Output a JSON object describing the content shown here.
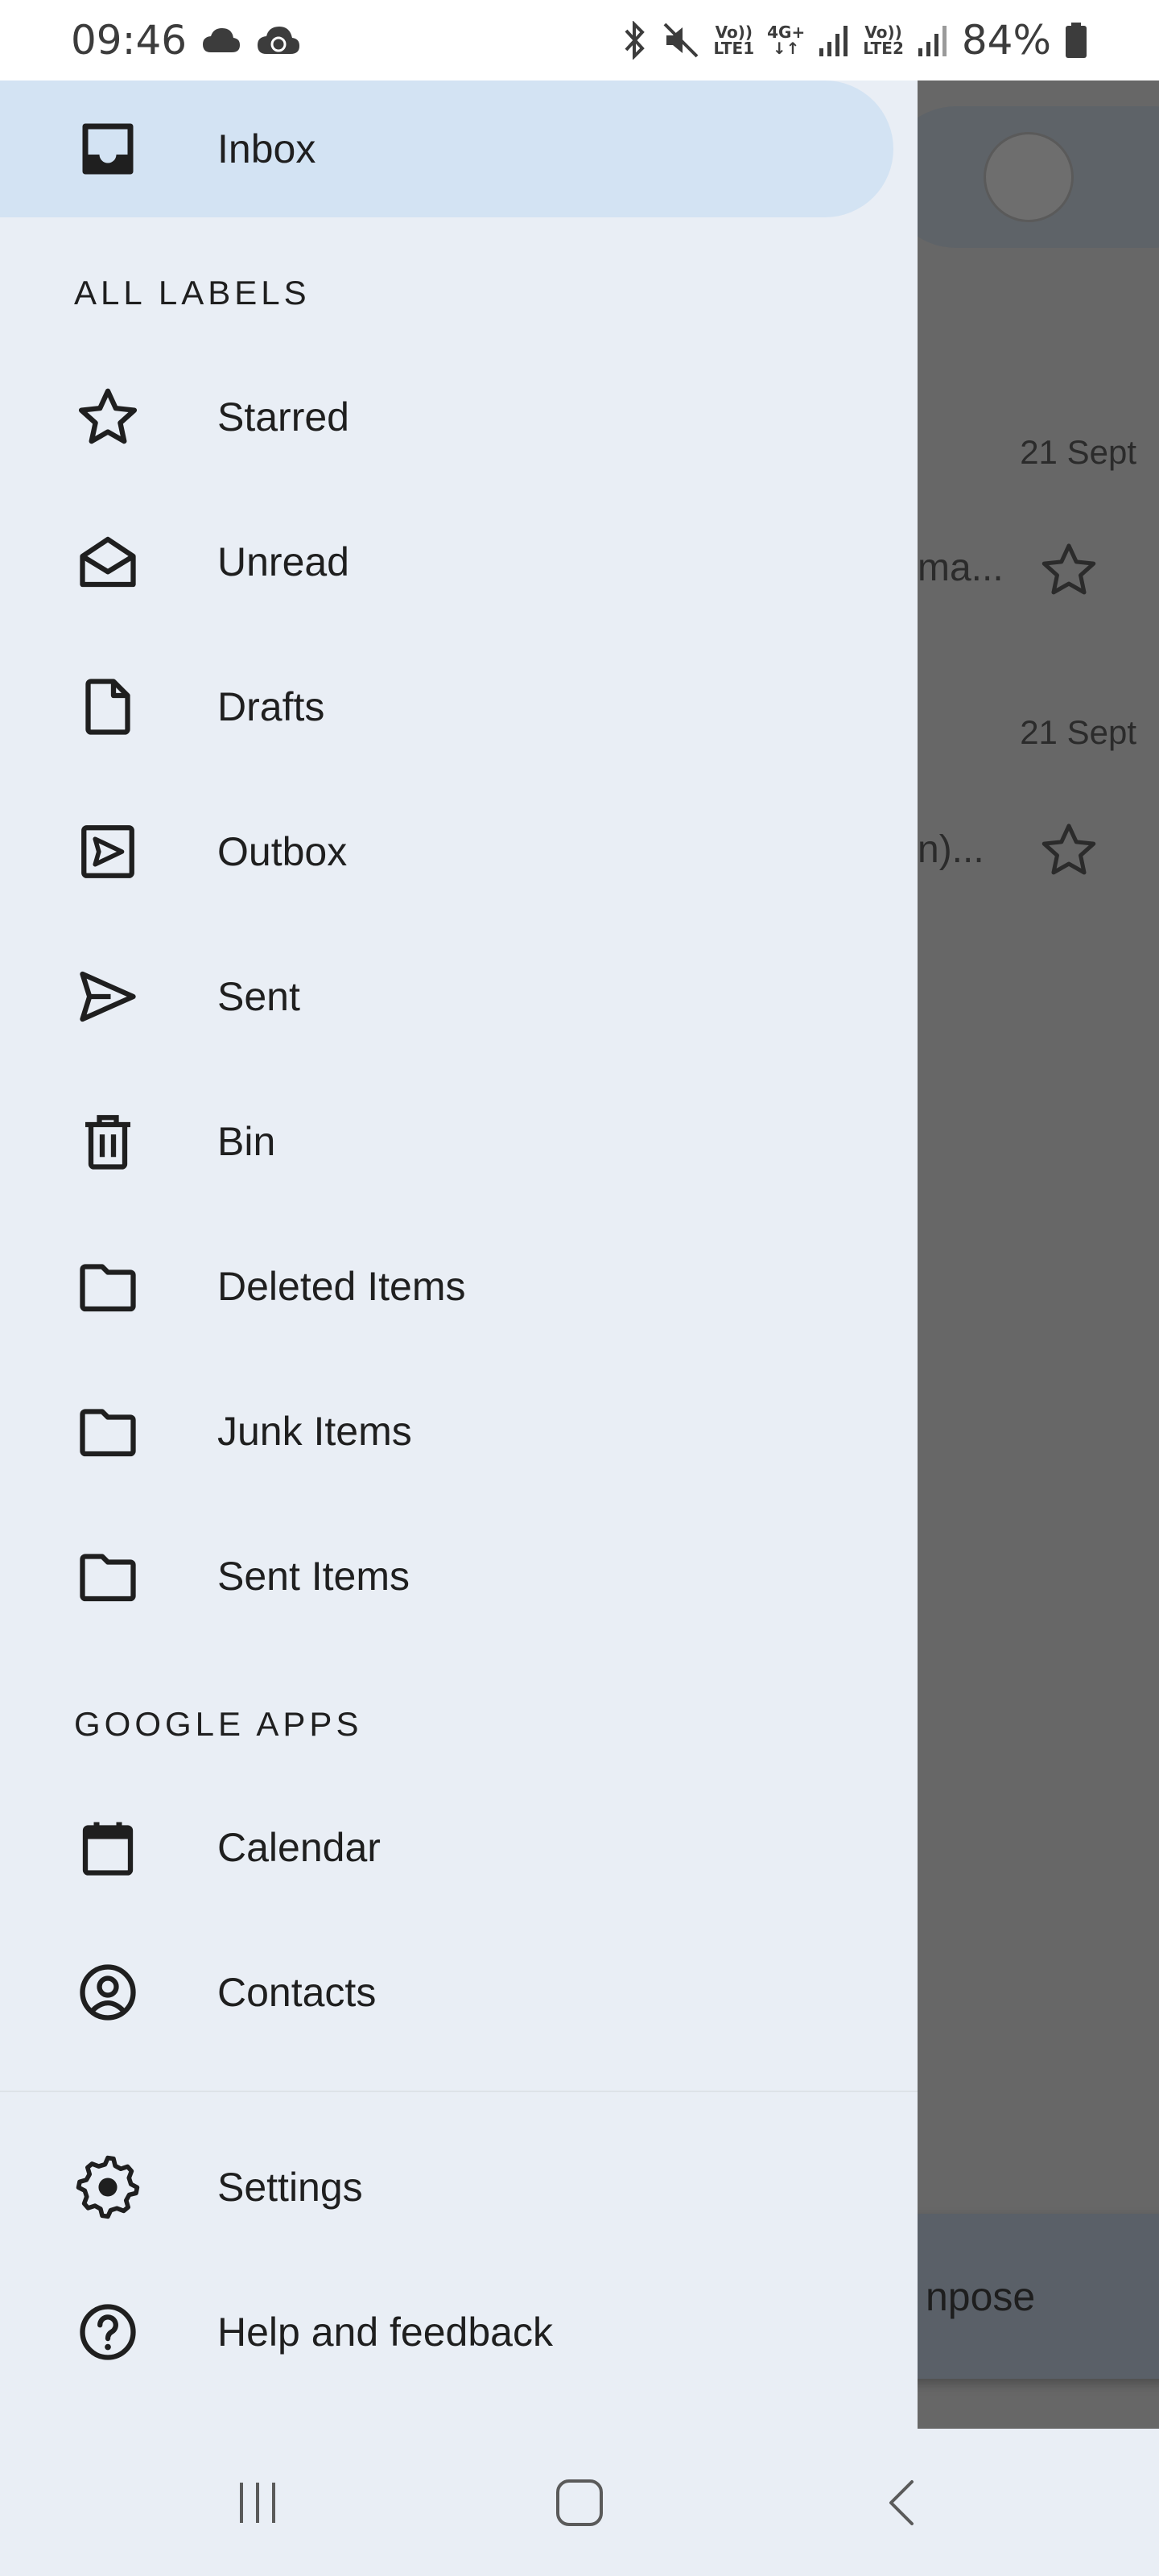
{
  "status_bar": {
    "time": "09:46",
    "battery_percent": "84%",
    "net1": [
      "Vo))",
      "LTE1"
    ],
    "net2": [
      "4G+",
      "↓↑"
    ],
    "net3": [
      "Vo))",
      "LTE2"
    ]
  },
  "drawer": {
    "inbox_label": "Inbox",
    "all_labels_header": "ALL LABELS",
    "labels": [
      {
        "label": "Starred",
        "icon": "star-icon"
      },
      {
        "label": "Unread",
        "icon": "open-envelope-icon"
      },
      {
        "label": "Drafts",
        "icon": "draft-document-icon"
      },
      {
        "label": "Outbox",
        "icon": "outbox-icon"
      },
      {
        "label": "Sent",
        "icon": "send-icon"
      },
      {
        "label": "Bin",
        "icon": "trash-icon"
      },
      {
        "label": "Deleted Items",
        "icon": "folder-icon"
      },
      {
        "label": "Junk Items",
        "icon": "folder-icon"
      },
      {
        "label": "Sent Items",
        "icon": "folder-icon"
      }
    ],
    "google_apps_header": "GOOGLE APPS",
    "apps": [
      {
        "label": "Calendar",
        "icon": "calendar-icon"
      },
      {
        "label": "Contacts",
        "icon": "contacts-icon"
      }
    ],
    "settings_label": "Settings",
    "help_label": "Help and feedback"
  },
  "background": {
    "email1_date": "21 Sept",
    "email1_snippet": "ma...",
    "email2_date": "21 Sept",
    "email2_snippet": "n)...",
    "compose_label": "npose"
  },
  "colors": {
    "drawer_bg": "#e9eef5",
    "selected_bg": "#d3e3f3",
    "overlay": "#676767"
  }
}
